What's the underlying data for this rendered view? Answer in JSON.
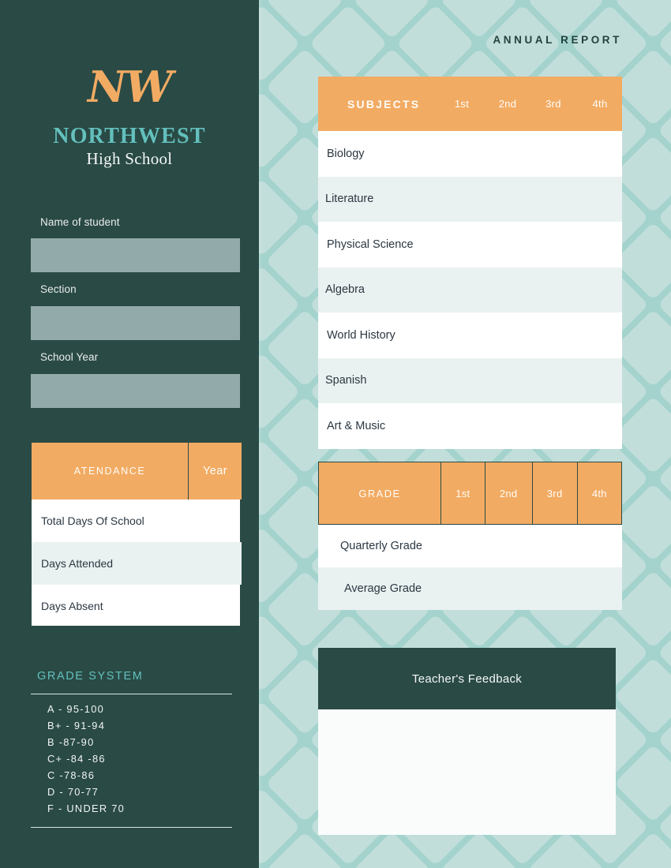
{
  "colors": {
    "sidebar_bg": "#2a4a45",
    "page_bg": "#a4d3cd",
    "pattern_light": "#c4e0dd",
    "accent_orange": "#f2ab63",
    "accent_teal": "#63c0bd",
    "row_alt": "#eaf1f1",
    "field_fill": "#93aaab"
  },
  "sidebar": {
    "logo_monogram": "NW",
    "school_name": "NORTHWEST",
    "school_subtitle": "High School",
    "fields": [
      {
        "label": "Name of student",
        "value": ""
      },
      {
        "label": "Section",
        "value": ""
      },
      {
        "label": "School Year",
        "value": ""
      }
    ],
    "attendance": {
      "header_label": "ATENDANCE",
      "header_year": "Year",
      "rows": [
        {
          "label": "Total Days Of School",
          "value": ""
        },
        {
          "label": "Days Attended",
          "value": ""
        },
        {
          "label": "Days Absent",
          "value": ""
        }
      ]
    },
    "grade_system": {
      "title": "GRADE SYSTEM",
      "entries": [
        "A -  95-100",
        "B+  -  91-94",
        "B  -87-90",
        "C+  -84 -86",
        "C  -78-86",
        "D -  70-77",
        "F -  UNDER 70"
      ]
    }
  },
  "main": {
    "page_title": "ANNUAL REPORT",
    "subjects_table": {
      "header_label": "SUBJECTS",
      "quarters": [
        "1st",
        "2nd",
        "3rd",
        "4th"
      ],
      "rows": [
        {
          "subject": "Biology",
          "q1": "",
          "q2": "",
          "q3": "",
          "q4": ""
        },
        {
          "subject": "Literature",
          "q1": "",
          "q2": "",
          "q3": "",
          "q4": ""
        },
        {
          "subject": "Physical Science",
          "q1": "",
          "q2": "",
          "q3": "",
          "q4": ""
        },
        {
          "subject": "Algebra",
          "q1": "",
          "q2": "",
          "q3": "",
          "q4": ""
        },
        {
          "subject": "World History",
          "q1": "",
          "q2": "",
          "q3": "",
          "q4": ""
        },
        {
          "subject": "Spanish",
          "q1": "",
          "q2": "",
          "q3": "",
          "q4": ""
        },
        {
          "subject": "Art & Music",
          "q1": "",
          "q2": "",
          "q3": "",
          "q4": ""
        }
      ]
    },
    "grade_table": {
      "header_label": "GRADE",
      "quarters": [
        "1st",
        "2nd",
        "3rd",
        "4th"
      ],
      "rows": [
        {
          "label": "Quarterly Grade",
          "q1": "",
          "q2": "",
          "q3": "",
          "q4": ""
        },
        {
          "label": "Average Grade",
          "q1": "",
          "q2": "",
          "q3": "",
          "q4": ""
        }
      ]
    },
    "feedback": {
      "header": "Teacher's Feedback",
      "body": ""
    }
  }
}
